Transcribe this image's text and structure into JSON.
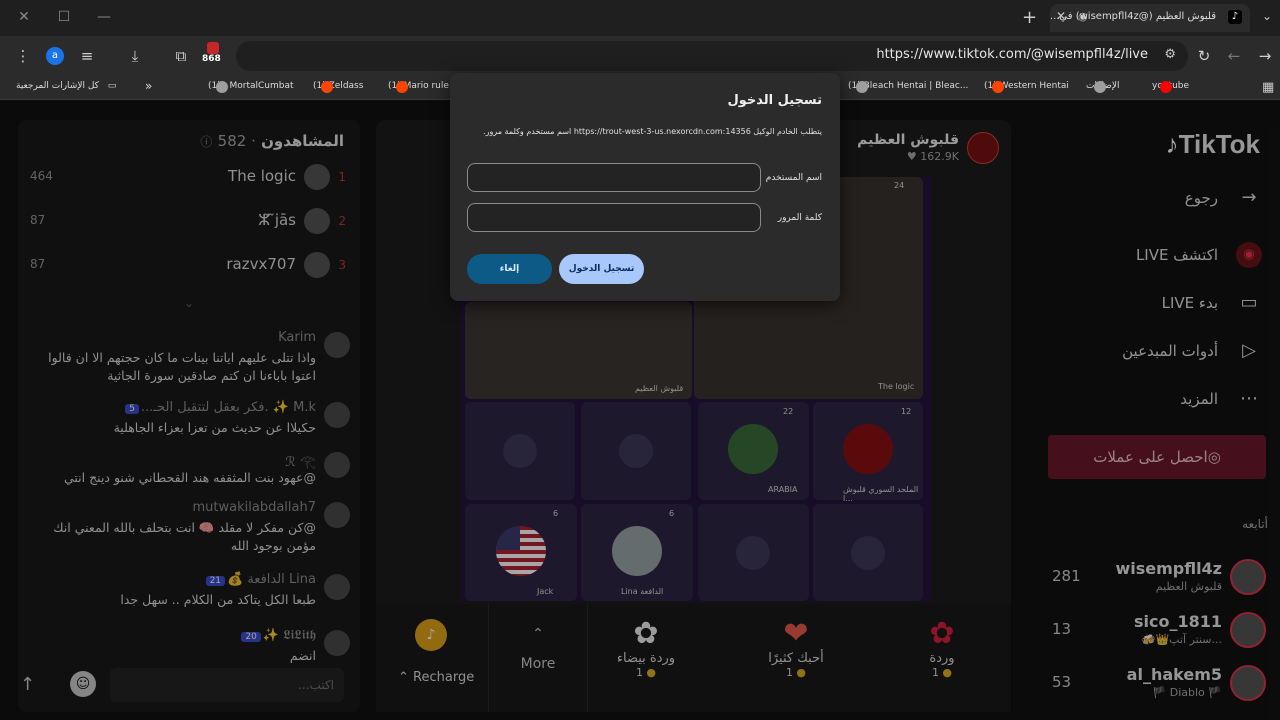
{
  "browser": {
    "tab_title": "قلبوش العظيم (@wisempfll4z) في...",
    "tab_favicon": "tiktok-icon",
    "url": "https://www.tiktok.com/@wisempfll4z/live",
    "extension_badge": "868",
    "bookmarks": [
      {
        "label": "youtube",
        "icon": "youtube-icon",
        "color": "#ff0000"
      },
      {
        "label": "الإضافات",
        "icon": "puzzle-icon",
        "color": "#9e9e9e"
      },
      {
        "label": "(1) Western Hentai",
        "icon": "reddit-icon",
        "color": "#ff4500"
      },
      {
        "label": "(1) Bleach Hentai | Bleac...",
        "icon": "globe-icon",
        "color": "#9e9e9e"
      },
      {
        "label": "(1) Mario rule 3",
        "icon": "reddit-icon",
        "color": "#ff4500"
      },
      {
        "label": "(1) Zeldass",
        "icon": "reddit-icon",
        "color": "#ff4500"
      },
      {
        "label": "(1) : MortalCumbat",
        "icon": "globe-icon",
        "color": "#9e9e9e"
      }
    ],
    "all_bookmarks": "كل الإشارات المرجعية",
    "bookmarks_overflow": "»"
  },
  "modal": {
    "title": "تسجيل الدخول",
    "message": "يتطلب الخادم الوكيل https://trout-west-3-us.nexorcdn.com:14356 اسم مستخدم وكلمة مرور.",
    "username_label": "اسم المستخدم",
    "password_label": "كلمة المرور",
    "username_value": "",
    "password_value": "",
    "login_button": "تسجيل الدخول",
    "cancel_button": "إلغاء"
  },
  "viewers": {
    "title": "المشاهدون",
    "count": "582",
    "top": [
      {
        "rank": "1",
        "name": "The logic",
        "score": "464"
      },
      {
        "rank": "2",
        "name": "ⵣ̃ ̃jās",
        "score": "87"
      },
      {
        "rank": "3",
        "name": "razvx707",
        "score": "87"
      }
    ]
  },
  "chat": [
    {
      "name": "Karim",
      "badges": "",
      "text": "واذا تتلى عليهم اياتنا بينات ما كان حجتهم الا ان قالوا اعتوا باباءنا ان كتم صادقين سورة الجاثية"
    },
    {
      "name": "M.k ✨ .فكر بعقل لتتقبل الحـ...",
      "badges": "5",
      "text": "حكيلاا عن حديث من تعزا بعزاء الجاهلية"
    },
    {
      "name": "ℛ 𓂀",
      "badges": "",
      "text": "@عهود بنت المثقفه هند القحطاني شنو دينج انتي"
    },
    {
      "name": "mutwakilabdallah7",
      "badges": "",
      "text": "@كن مفكر لا مقلد 🧠 انت بتحلف بالله المعني انك مؤمن بوجود الله"
    },
    {
      "name": "Lina الدافعة 💰",
      "badges": "21",
      "text": "طبعا الكل يتاكد من الكلام .. سهل جدا"
    },
    {
      "name": "𝕷𝖎𝕷𝖎𝖙𝖍 ✨",
      "badges": "20",
      "text": "انضم"
    }
  ],
  "chat_input_placeholder": "اكتب...",
  "stream": {
    "host_name": "قلبوش العظيم",
    "host_likes": "162.9K",
    "participants": [
      {
        "label": "The logic",
        "count": "24"
      },
      {
        "label": "قلبوش العظيم",
        "count": ""
      },
      {
        "label": "الملحد السوري قلبوش ا...",
        "count": "12"
      },
      {
        "label": "ARABIA",
        "count": "22"
      },
      {
        "label": "Lina الدافعة",
        "count": "6"
      },
      {
        "label": "Jack",
        "count": "6"
      }
    ]
  },
  "gifts": [
    {
      "name": "وردة",
      "price": "1"
    },
    {
      "name": "أحبك كثيرًا",
      "price": "1"
    },
    {
      "name": "وردة بيضاء",
      "price": "1"
    },
    {
      "name": "More",
      "price": ""
    },
    {
      "name": "Recharge",
      "price": ""
    }
  ],
  "sidebar": {
    "logo": "TikTok",
    "nav": [
      {
        "label": "رجوع",
        "icon": "arrow-icon"
      },
      {
        "label": "اكتشف LIVE",
        "icon": "live-icon"
      },
      {
        "label": "بدء LIVE",
        "icon": "camera-icon"
      },
      {
        "label": "أدوات المبدعين",
        "icon": "play-icon"
      },
      {
        "label": "المزيد",
        "icon": "more-icon"
      }
    ],
    "coins_button": "احصل على عملات",
    "following_title": "أتابعه",
    "following": [
      {
        "name": "wisempfll4z",
        "sub": "قلبوش العظيم",
        "count": "281"
      },
      {
        "name": "sico_1811",
        "sub": "...سنتر آتپ👑🍻",
        "count": "13"
      },
      {
        "name": "al_hakem5",
        "sub": "🏴 Diablo 🏴",
        "count": "53"
      }
    ]
  }
}
